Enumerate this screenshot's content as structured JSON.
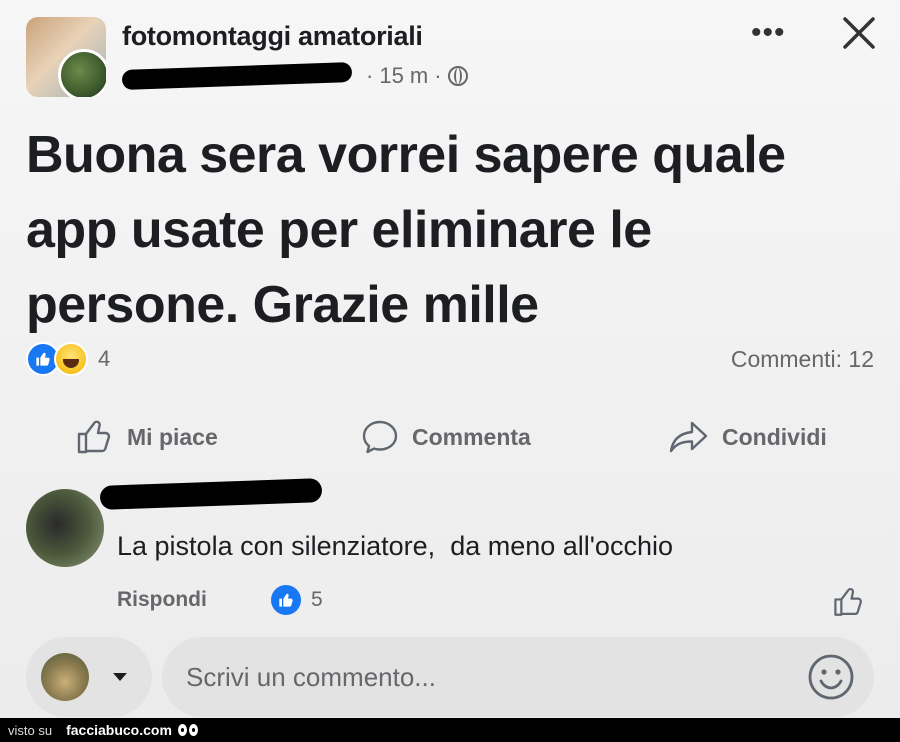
{
  "post": {
    "group_name": "fotomontaggi amatoriali",
    "time": "15 m",
    "separator": "·",
    "text": "Buona sera vorrei sapere quale app usate per eliminare le persone. Grazie mille",
    "reaction_count": "4",
    "comments_label": "Commenti: 12"
  },
  "actions": {
    "like": "Mi piace",
    "comment": "Commenta",
    "share": "Condividi"
  },
  "comment": {
    "text": "La pistola con silenziatore,  da meno all'occhio",
    "reply_label": "Rispondi",
    "like_count": "5"
  },
  "composer": {
    "placeholder": "Scrivi un commento..."
  },
  "watermark": {
    "prefix": "visto su",
    "site": "facciabuco.com"
  },
  "colors": {
    "facebook_blue": "#1877f2",
    "secondary_text": "#65676b",
    "primary_text": "#1c1e21"
  },
  "icons": [
    "more-icon",
    "close-icon",
    "globe-icon",
    "like-reaction-icon",
    "haha-reaction-icon",
    "thumbs-up-icon",
    "comment-bubble-icon",
    "share-arrow-icon",
    "chevron-down-icon",
    "emoji-icon"
  ]
}
